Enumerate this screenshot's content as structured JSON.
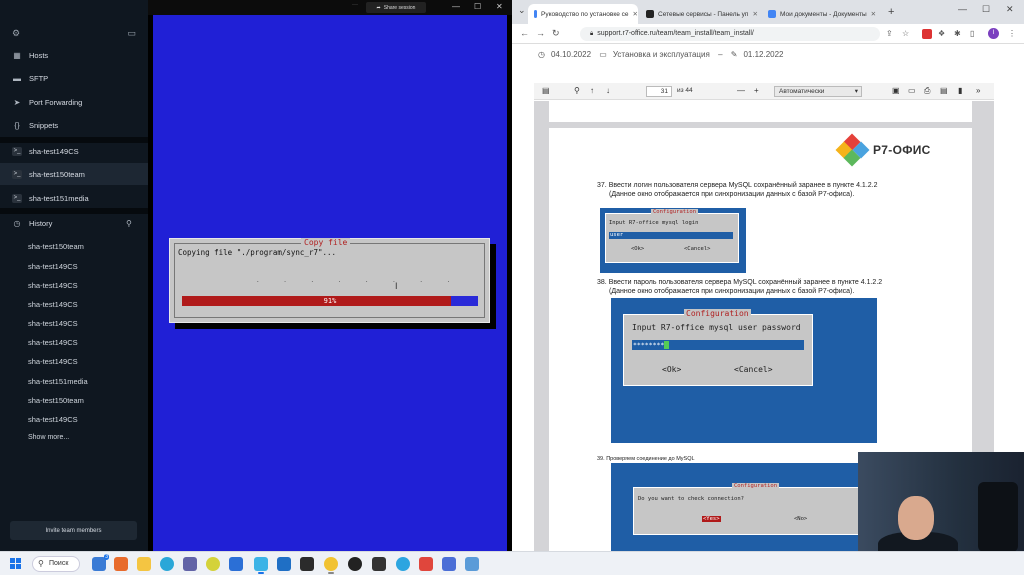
{
  "termius": {
    "nav": [
      {
        "label": "Hosts",
        "icon": "hosts-icon"
      },
      {
        "label": "SFTP",
        "icon": "folder-icon"
      },
      {
        "label": "Port Forwarding",
        "icon": "forward-arrow-icon"
      },
      {
        "label": "Snippets",
        "icon": "braces-icon"
      }
    ],
    "sessions": [
      "sha-test149CS",
      "sha-test150team",
      "sha-test151media"
    ],
    "active_session": "sha-test150team",
    "history_label": "History",
    "history": [
      "sha-test150team",
      "sha-test149CS",
      "sha-test149CS",
      "sha-test149CS",
      "sha-test149CS",
      "sha-test149CS",
      "sha-test149CS",
      "sha-test151media",
      "sha-test150team",
      "sha-test149CS"
    ],
    "show_more": "Show more...",
    "invite": "Invite team members"
  },
  "terminal": {
    "share_label": "Share session",
    "dialog_title": "Copy file",
    "dialog_message": "Copying file \"./program/sync_r7\"...",
    "progress_percent": 91,
    "progress_text": "91%",
    "colors": {
      "background": "#2020d6",
      "progress_fill": "#b01a1a"
    }
  },
  "chrome": {
    "tabs": [
      {
        "title": "Руководство по установке се",
        "active": true,
        "favicon": "#4285f4"
      },
      {
        "title": "Сетевые сервисы - Панель уп",
        "active": false,
        "favicon": "#222222"
      },
      {
        "title": "Мои документы - Документы",
        "active": false,
        "favicon": "#4285f4"
      }
    ],
    "url": "support.r7-office.ru/team/team_install/team_install/",
    "avatar_letter": "I"
  },
  "page": {
    "date_published": "04.10.2022",
    "category": "Установка и эксплуатация",
    "date_updated": "01.12.2022",
    "pdf": {
      "page_number": "31",
      "page_count": "из 44",
      "zoom": "Автоматически"
    },
    "logo_text": "Р7-ОФИС",
    "step37": {
      "number": "37.",
      "line1": "Ввести логин пользователя сервера MySQL сохранённый заранее в пункте 4.1.2.2",
      "line2": "(Данное окно отображается при синхронизации данных с базой Р7-офиса).",
      "dialog_title": "Configuration",
      "dialog_text": "Input R7-office mysql login",
      "input_value": "user",
      "ok": "<Ok>",
      "cancel": "<Cancel>"
    },
    "step38": {
      "number": "38.",
      "line1": "Ввести пароль пользователя сервера MySQL сохранённый заранее в пункте 4.1.2.2",
      "line2": "(Данное окно отображается при синхронизации данных с базой Р7-офиса).",
      "dialog_title": "Configuration",
      "dialog_text": "Input R7-office mysql user password",
      "input_value": "********",
      "ok": "<Ok>",
      "cancel": "<Cancel>"
    },
    "step39": {
      "number": "39.",
      "line1": "Проверяем соединение до MySQL",
      "dialog_title": "Configuration",
      "dialog_text": "Do you want to check connection?",
      "yes": "<Yes>",
      "no": "<No>"
    }
  },
  "taskbar": {
    "search_label": "Поиск",
    "badge": "3"
  }
}
